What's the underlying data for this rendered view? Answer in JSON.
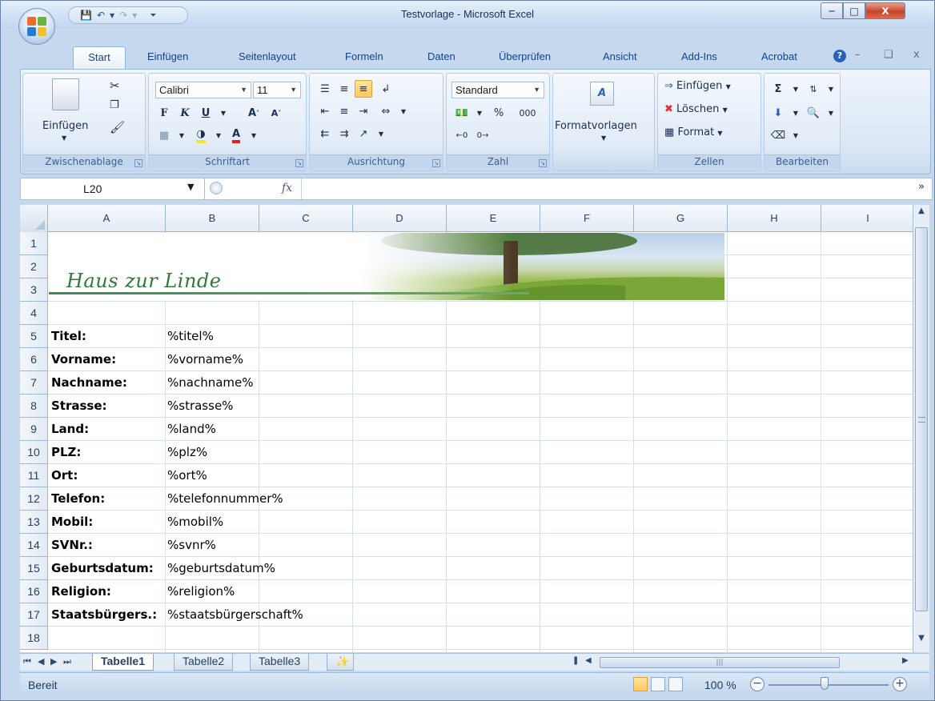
{
  "window": {
    "title": "Testvorlage - Microsoft Excel",
    "controls": [
      "minimize",
      "maximize",
      "close"
    ]
  },
  "quick_access": {
    "icons": [
      "save-icon",
      "undo-icon",
      "redo-icon",
      "customize-icon"
    ]
  },
  "ribbon": {
    "tabs": [
      "Start",
      "Einfügen",
      "Seitenlayout",
      "Formeln",
      "Daten",
      "Überprüfen",
      "Ansicht",
      "Add-Ins",
      "Acrobat"
    ],
    "active_tab": "Start",
    "groups": {
      "clipboard": {
        "label": "Zwischenablage",
        "paste_label": "Einfügen"
      },
      "font": {
        "label": "Schriftart",
        "font_name": "Calibri",
        "font_size": "11",
        "bold": "F",
        "italic": "K",
        "underline": "U"
      },
      "alignment": {
        "label": "Ausrichtung"
      },
      "number": {
        "label": "Zahl",
        "format": "Standard",
        "percent": "%",
        "thousands": "000"
      },
      "styles": {
        "label": "Formatvorlagen"
      },
      "cells": {
        "label": "Zellen",
        "insert": "Einfügen",
        "delete": "Löschen",
        "format": "Format"
      },
      "editing": {
        "label": "Bearbeiten"
      }
    }
  },
  "formula_bar": {
    "name_box": "L20",
    "fx_label": "fx",
    "formula": ""
  },
  "sheet": {
    "columns": [
      "A",
      "B",
      "C",
      "D",
      "E",
      "F",
      "G",
      "H",
      "I"
    ],
    "rows": [
      "1",
      "2",
      "3",
      "4",
      "5",
      "6",
      "7",
      "8",
      "9",
      "10",
      "11",
      "12",
      "13",
      "14",
      "15",
      "16",
      "17",
      "18"
    ],
    "banner_title": "Haus zur Linde",
    "fields": [
      {
        "label": "Titel:",
        "value": "%titel%"
      },
      {
        "label": "Vorname:",
        "value": "%vorname%"
      },
      {
        "label": "Nachname:",
        "value": "%nachname%"
      },
      {
        "label": "Strasse:",
        "value": "%strasse%"
      },
      {
        "label": "Land:",
        "value": "%land%"
      },
      {
        "label": "PLZ:",
        "value": "%plz%"
      },
      {
        "label": "Ort:",
        "value": "%ort%"
      },
      {
        "label": "Telefon:",
        "value": "%telefonnummer%"
      },
      {
        "label": "Mobil:",
        "value": "%mobil%"
      },
      {
        "label": "SVNr.:",
        "value": "%svnr%"
      },
      {
        "label": "Geburtsdatum:",
        "value": "%geburtsdatum%"
      },
      {
        "label": "Religion:",
        "value": "%religion%"
      },
      {
        "label": "Staatsbürgers.:",
        "value": "%staatsbürgerschaft%"
      }
    ]
  },
  "sheet_tabs": [
    "Tabelle1",
    "Tabelle2",
    "Tabelle3"
  ],
  "active_sheet": "Tabelle1",
  "status_bar": {
    "status": "Bereit",
    "zoom": "100 %"
  }
}
